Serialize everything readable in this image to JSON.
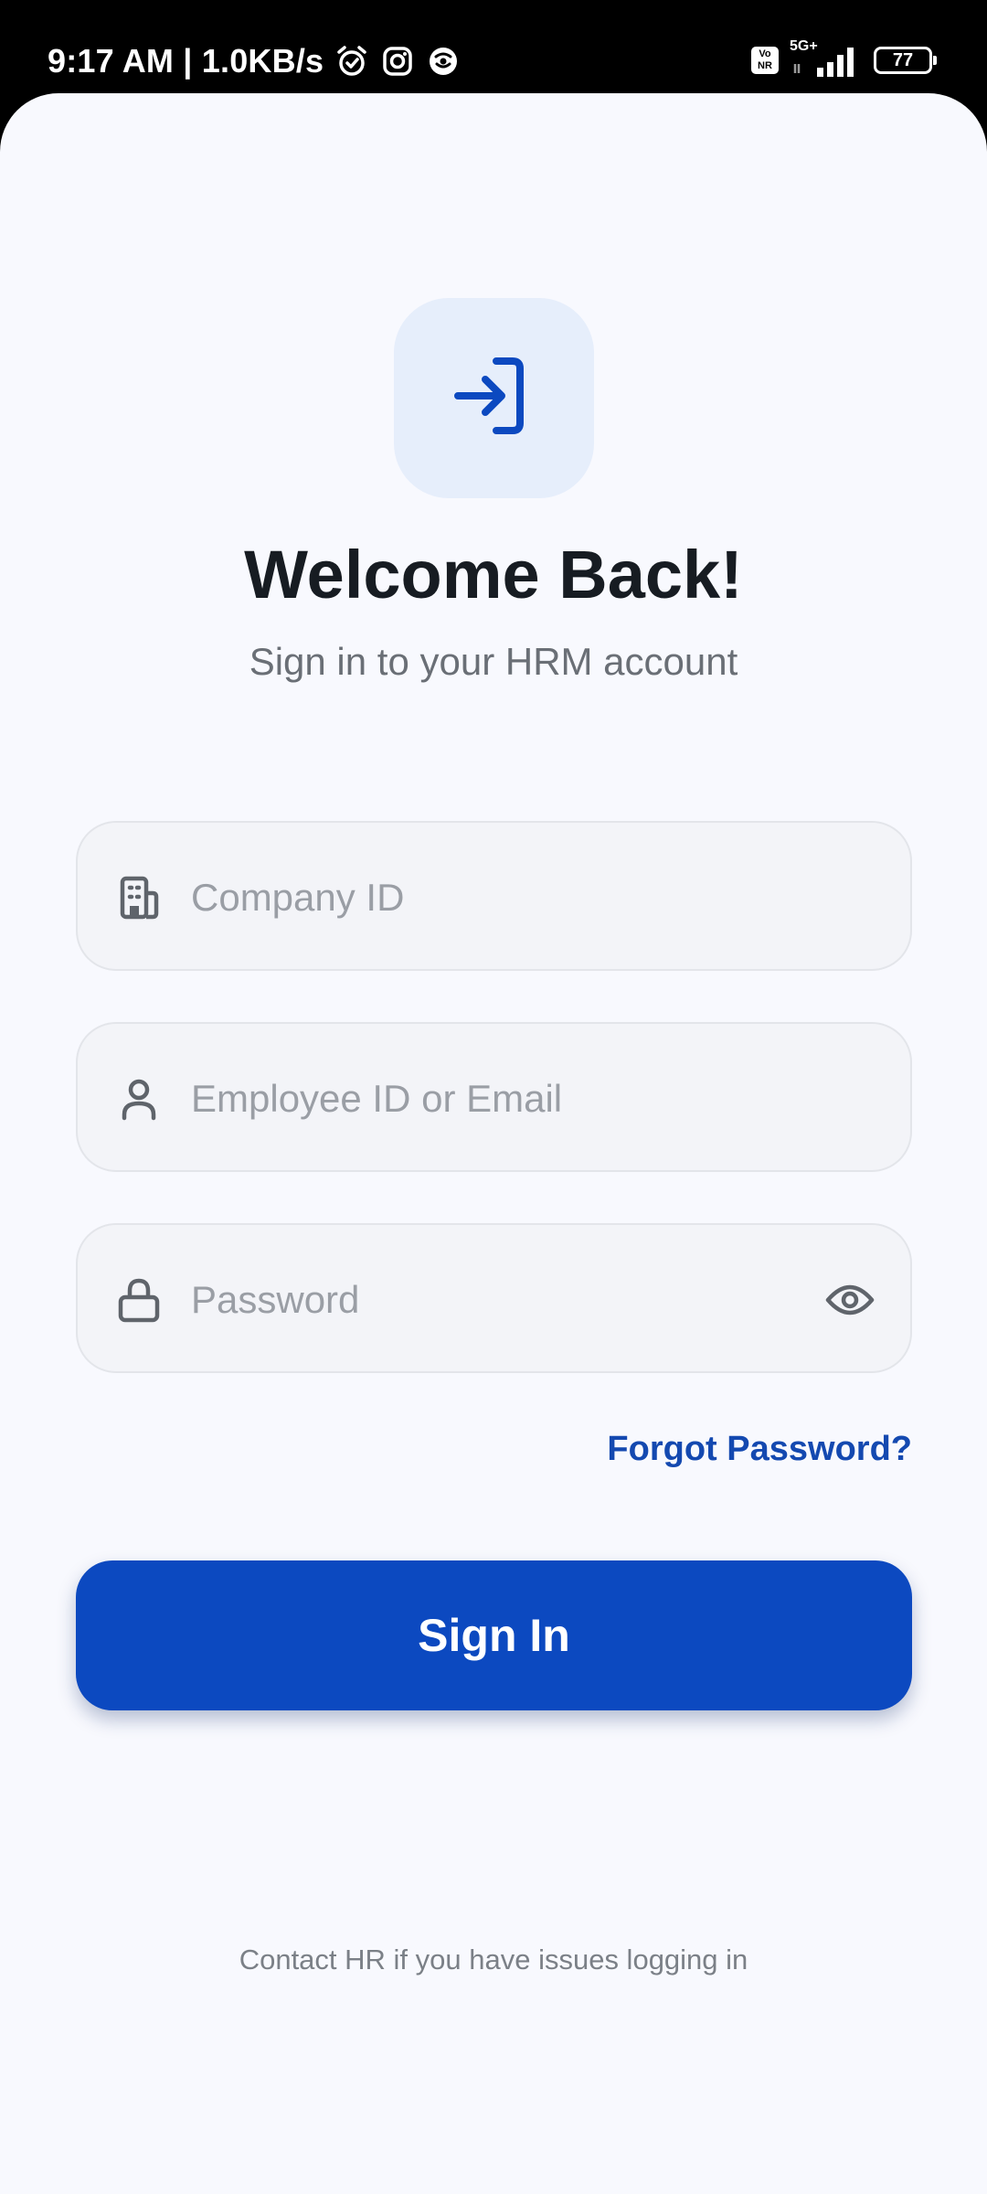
{
  "status_bar": {
    "time": "9:17 AM | 1.0KB/s",
    "volte_label": "Vo\nNR",
    "network": "5G+",
    "battery": "77",
    "icons": [
      "alarm-icon",
      "instagram-icon",
      "vpn-icon",
      "signal-icon",
      "battery-icon"
    ]
  },
  "header": {
    "logo_icon": "login-arrow-icon",
    "title": "Welcome Back!",
    "subtitle": "Sign in to your HRM account"
  },
  "form": {
    "company": {
      "placeholder": "Company ID",
      "value": "",
      "icon": "building-icon"
    },
    "employee": {
      "placeholder": "Employee ID or Email",
      "value": "",
      "icon": "user-icon"
    },
    "password": {
      "placeholder": "Password",
      "value": "",
      "icon": "lock-icon",
      "toggle_icon": "eye-icon"
    },
    "forgot_label": "Forgot Password?",
    "submit_label": "Sign In"
  },
  "footer": {
    "note": "Contact HR if you have issues logging in"
  },
  "colors": {
    "accent": "#0c49c0",
    "link": "#1449b0",
    "background": "#f8f9fe",
    "field_bg": "#f3f4f8",
    "title": "#171c22"
  }
}
